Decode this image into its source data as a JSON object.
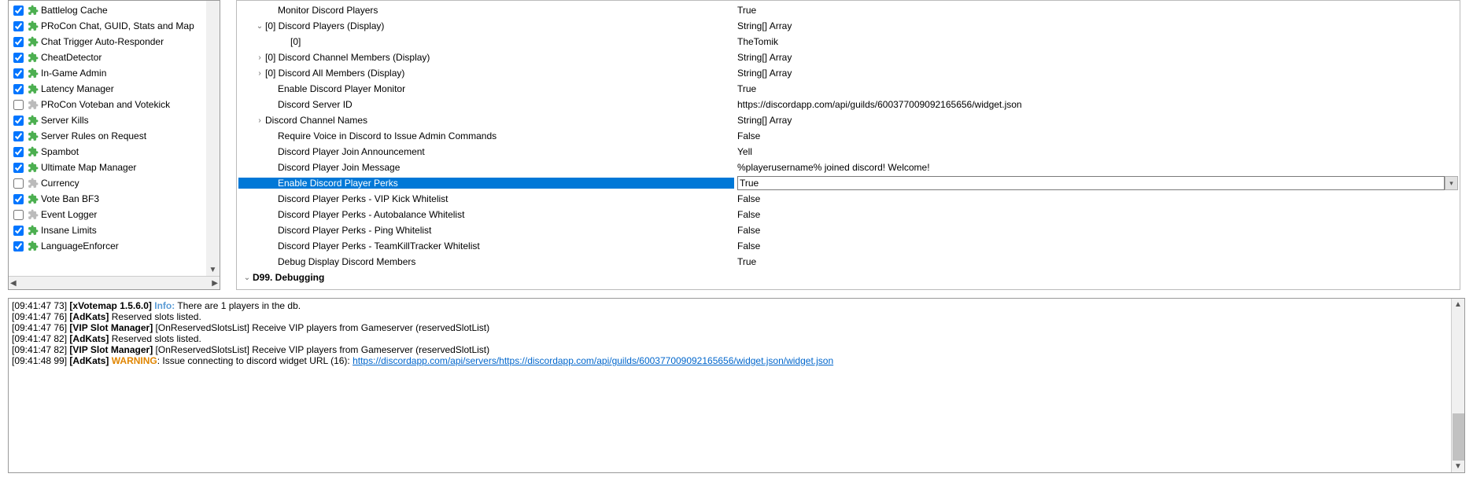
{
  "plugins": [
    {
      "checked": true,
      "enabled": true,
      "label": "Battlelog Cache"
    },
    {
      "checked": true,
      "enabled": true,
      "label": "PRoCon Chat, GUID, Stats and Map"
    },
    {
      "checked": true,
      "enabled": true,
      "label": "Chat Trigger Auto-Responder"
    },
    {
      "checked": true,
      "enabled": true,
      "label": "CheatDetector"
    },
    {
      "checked": true,
      "enabled": true,
      "label": "In-Game Admin"
    },
    {
      "checked": true,
      "enabled": true,
      "label": "Latency Manager"
    },
    {
      "checked": false,
      "enabled": false,
      "label": "PRoCon Voteban and Votekick"
    },
    {
      "checked": true,
      "enabled": true,
      "label": "Server Kills"
    },
    {
      "checked": true,
      "enabled": true,
      "label": "Server Rules on Request"
    },
    {
      "checked": true,
      "enabled": true,
      "label": "Spambot"
    },
    {
      "checked": true,
      "enabled": true,
      "label": "Ultimate Map Manager"
    },
    {
      "checked": false,
      "enabled": false,
      "label": "Currency"
    },
    {
      "checked": true,
      "enabled": true,
      "label": "Vote Ban BF3"
    },
    {
      "checked": false,
      "enabled": false,
      "label": "Event Logger"
    },
    {
      "checked": true,
      "enabled": true,
      "label": "Insane Limits"
    },
    {
      "checked": true,
      "enabled": true,
      "label": "LanguageEnforcer"
    }
  ],
  "props": [
    {
      "indent": 2,
      "key": "Monitor Discord Players",
      "val": "True"
    },
    {
      "indent": 1,
      "exp": "v",
      "key": "[0] Discord Players (Display)",
      "val": "String[] Array"
    },
    {
      "indent": 3,
      "key": "[0]",
      "val": "TheTomik"
    },
    {
      "indent": 1,
      "exp": ">",
      "key": "[0] Discord Channel Members (Display)",
      "val": "String[] Array"
    },
    {
      "indent": 1,
      "exp": ">",
      "key": "[0] Discord All Members (Display)",
      "val": "String[] Array"
    },
    {
      "indent": 2,
      "key": "Enable Discord Player Monitor",
      "val": "True"
    },
    {
      "indent": 2,
      "key": "Discord Server ID",
      "val": "https://discordapp.com/api/guilds/600377009092165656/widget.json"
    },
    {
      "indent": 1,
      "exp": ">",
      "key": "Discord Channel Names",
      "val": "String[] Array"
    },
    {
      "indent": 2,
      "key": "Require Voice in Discord to Issue Admin Commands",
      "val": "False"
    },
    {
      "indent": 2,
      "key": "Discord Player Join Announcement",
      "val": "Yell"
    },
    {
      "indent": 2,
      "key": "Discord Player Join Message",
      "val": "%playerusername% joined discord! Welcome!"
    },
    {
      "indent": 2,
      "key": "Enable Discord Player Perks",
      "val": "True",
      "selected": true
    },
    {
      "indent": 2,
      "key": "Discord Player Perks - VIP Kick Whitelist",
      "val": "False"
    },
    {
      "indent": 2,
      "key": "Discord Player Perks - Autobalance Whitelist",
      "val": "False"
    },
    {
      "indent": 2,
      "key": "Discord Player Perks - Ping Whitelist",
      "val": "False"
    },
    {
      "indent": 2,
      "key": "Discord Player Perks - TeamKillTracker Whitelist",
      "val": "False"
    },
    {
      "indent": 2,
      "key": "Debug Display Discord Members",
      "val": "True"
    },
    {
      "indent": 0,
      "exp": "v",
      "key": "D99. Debugging",
      "val": "",
      "bold": true
    }
  ],
  "logs": [
    {
      "ts": "[09:41:47 73]",
      "plugin": "[xVotemap 1.5.6.0]",
      "tag": "Info:",
      "tagclass": "log-info",
      "msg": " There are 1 players in the db."
    },
    {
      "ts": "[09:41:47 76]",
      "plugin": "[AdKats]",
      "msg": " Reserved slots listed."
    },
    {
      "ts": "[09:41:47 76]",
      "plugin": "[VIP Slot Manager]",
      "msg": " [OnReservedSlotsList] Receive VIP players from Gameserver (reservedSlotList)"
    },
    {
      "ts": "[09:41:47 82]",
      "plugin": "[AdKats]",
      "msg": " Reserved slots listed."
    },
    {
      "ts": "[09:41:47 82]",
      "plugin": "[VIP Slot Manager]",
      "msg": " [OnReservedSlotsList] Receive VIP players from Gameserver (reservedSlotList)"
    },
    {
      "ts": "[09:41:48 99]",
      "plugin": "[AdKats]",
      "tag": "WARNING",
      "tagclass": "log-warn",
      "msg": ": Issue connecting to discord widget URL (16): ",
      "link": "https://discordapp.com/api/servers/https://discordapp.com/api/guilds/600377009092165656/widget.json/widget.json"
    }
  ]
}
